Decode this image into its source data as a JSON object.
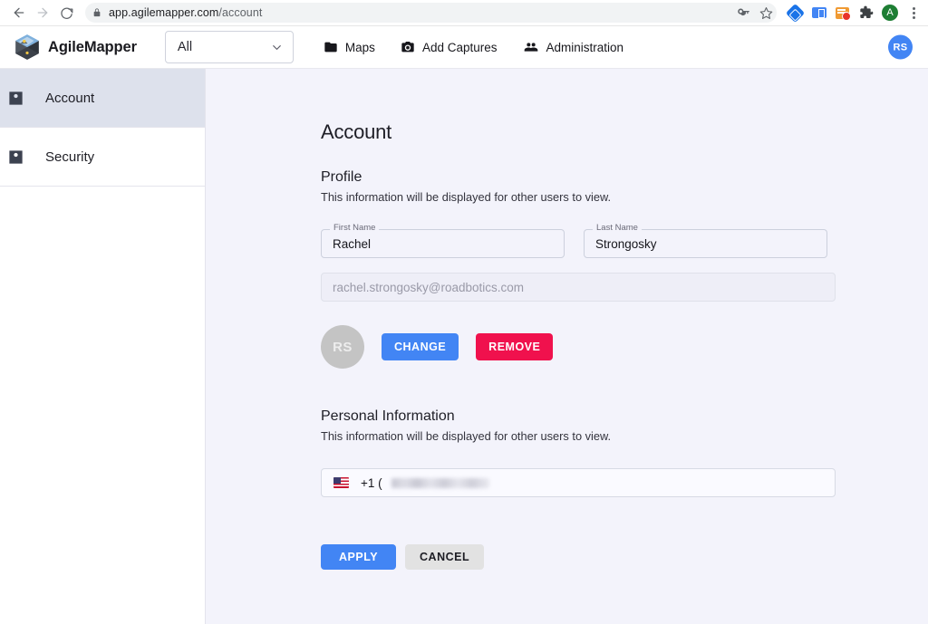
{
  "browser": {
    "back_icon": "back-arrow-icon",
    "forward_icon": "forward-arrow-icon",
    "reload_icon": "reload-icon",
    "lock_icon": "lock-icon",
    "url_host": "app.agilemapper.com",
    "url_path": "/account",
    "key_icon": "key-icon",
    "star_icon": "star-icon",
    "extensions": [
      "blue-diamond-extension-icon",
      "blue-card-extension-icon",
      "orange-badge-extension-icon",
      "puzzle-extension-icon"
    ],
    "profile_initial": "A",
    "menu_icon": "three-dot-menu-icon"
  },
  "header": {
    "brand_name": "AgileMapper",
    "logo_icon": "agilemapper-cube-logo",
    "scope_value": "All",
    "chevron_icon": "chevron-down-icon",
    "nav": [
      {
        "label": "Maps",
        "icon": "folder-icon"
      },
      {
        "label": "Add Captures",
        "icon": "camera-icon"
      },
      {
        "label": "Administration",
        "icon": "people-group-icon"
      }
    ],
    "avatar_initials": "RS",
    "avatar_color": "#4285f4"
  },
  "sidebar": {
    "items": [
      {
        "label": "Account",
        "icon": "account-box-icon",
        "active": true
      },
      {
        "label": "Security",
        "icon": "account-box-icon",
        "active": false
      }
    ]
  },
  "main": {
    "page_title": "Account",
    "profile": {
      "section_title": "Profile",
      "section_sub": "This information will be displayed for other users to view.",
      "first_name_label": "First Name",
      "first_name_value": "Rachel",
      "last_name_label": "Last Name",
      "last_name_value": "Strongosky",
      "email_value": "rachel.strongosky@roadbotics.com",
      "avatar_initials": "RS",
      "change_label": "CHANGE",
      "remove_label": "REMOVE",
      "change_color": "#4285f4",
      "remove_color": "#f0114d"
    },
    "personal": {
      "section_title": "Personal Information",
      "section_sub": "This information will be displayed for other users to view.",
      "phone_flag": "us-flag-icon",
      "phone_prefix": "+1 ("
    },
    "actions": {
      "apply_label": "APPLY",
      "cancel_label": "CANCEL"
    }
  }
}
